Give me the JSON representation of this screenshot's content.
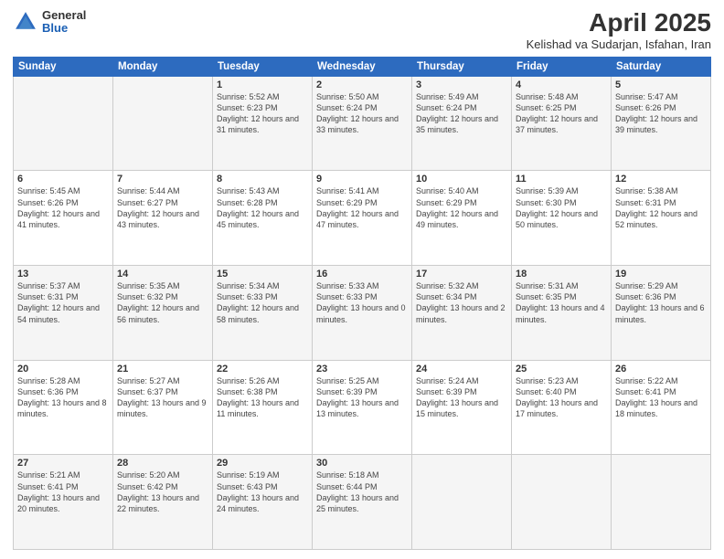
{
  "logo": {
    "general": "General",
    "blue": "Blue"
  },
  "header": {
    "title": "April 2025",
    "subtitle": "Kelishad va Sudarjan, Isfahan, Iran"
  },
  "days_of_week": [
    "Sunday",
    "Monday",
    "Tuesday",
    "Wednesday",
    "Thursday",
    "Friday",
    "Saturday"
  ],
  "weeks": [
    [
      {
        "day": "",
        "info": ""
      },
      {
        "day": "",
        "info": ""
      },
      {
        "day": "1",
        "info": "Sunrise: 5:52 AM\nSunset: 6:23 PM\nDaylight: 12 hours and 31 minutes."
      },
      {
        "day": "2",
        "info": "Sunrise: 5:50 AM\nSunset: 6:24 PM\nDaylight: 12 hours and 33 minutes."
      },
      {
        "day": "3",
        "info": "Sunrise: 5:49 AM\nSunset: 6:24 PM\nDaylight: 12 hours and 35 minutes."
      },
      {
        "day": "4",
        "info": "Sunrise: 5:48 AM\nSunset: 6:25 PM\nDaylight: 12 hours and 37 minutes."
      },
      {
        "day": "5",
        "info": "Sunrise: 5:47 AM\nSunset: 6:26 PM\nDaylight: 12 hours and 39 minutes."
      }
    ],
    [
      {
        "day": "6",
        "info": "Sunrise: 5:45 AM\nSunset: 6:26 PM\nDaylight: 12 hours and 41 minutes."
      },
      {
        "day": "7",
        "info": "Sunrise: 5:44 AM\nSunset: 6:27 PM\nDaylight: 12 hours and 43 minutes."
      },
      {
        "day": "8",
        "info": "Sunrise: 5:43 AM\nSunset: 6:28 PM\nDaylight: 12 hours and 45 minutes."
      },
      {
        "day": "9",
        "info": "Sunrise: 5:41 AM\nSunset: 6:29 PM\nDaylight: 12 hours and 47 minutes."
      },
      {
        "day": "10",
        "info": "Sunrise: 5:40 AM\nSunset: 6:29 PM\nDaylight: 12 hours and 49 minutes."
      },
      {
        "day": "11",
        "info": "Sunrise: 5:39 AM\nSunset: 6:30 PM\nDaylight: 12 hours and 50 minutes."
      },
      {
        "day": "12",
        "info": "Sunrise: 5:38 AM\nSunset: 6:31 PM\nDaylight: 12 hours and 52 minutes."
      }
    ],
    [
      {
        "day": "13",
        "info": "Sunrise: 5:37 AM\nSunset: 6:31 PM\nDaylight: 12 hours and 54 minutes."
      },
      {
        "day": "14",
        "info": "Sunrise: 5:35 AM\nSunset: 6:32 PM\nDaylight: 12 hours and 56 minutes."
      },
      {
        "day": "15",
        "info": "Sunrise: 5:34 AM\nSunset: 6:33 PM\nDaylight: 12 hours and 58 minutes."
      },
      {
        "day": "16",
        "info": "Sunrise: 5:33 AM\nSunset: 6:33 PM\nDaylight: 13 hours and 0 minutes."
      },
      {
        "day": "17",
        "info": "Sunrise: 5:32 AM\nSunset: 6:34 PM\nDaylight: 13 hours and 2 minutes."
      },
      {
        "day": "18",
        "info": "Sunrise: 5:31 AM\nSunset: 6:35 PM\nDaylight: 13 hours and 4 minutes."
      },
      {
        "day": "19",
        "info": "Sunrise: 5:29 AM\nSunset: 6:36 PM\nDaylight: 13 hours and 6 minutes."
      }
    ],
    [
      {
        "day": "20",
        "info": "Sunrise: 5:28 AM\nSunset: 6:36 PM\nDaylight: 13 hours and 8 minutes."
      },
      {
        "day": "21",
        "info": "Sunrise: 5:27 AM\nSunset: 6:37 PM\nDaylight: 13 hours and 9 minutes."
      },
      {
        "day": "22",
        "info": "Sunrise: 5:26 AM\nSunset: 6:38 PM\nDaylight: 13 hours and 11 minutes."
      },
      {
        "day": "23",
        "info": "Sunrise: 5:25 AM\nSunset: 6:39 PM\nDaylight: 13 hours and 13 minutes."
      },
      {
        "day": "24",
        "info": "Sunrise: 5:24 AM\nSunset: 6:39 PM\nDaylight: 13 hours and 15 minutes."
      },
      {
        "day": "25",
        "info": "Sunrise: 5:23 AM\nSunset: 6:40 PM\nDaylight: 13 hours and 17 minutes."
      },
      {
        "day": "26",
        "info": "Sunrise: 5:22 AM\nSunset: 6:41 PM\nDaylight: 13 hours and 18 minutes."
      }
    ],
    [
      {
        "day": "27",
        "info": "Sunrise: 5:21 AM\nSunset: 6:41 PM\nDaylight: 13 hours and 20 minutes."
      },
      {
        "day": "28",
        "info": "Sunrise: 5:20 AM\nSunset: 6:42 PM\nDaylight: 13 hours and 22 minutes."
      },
      {
        "day": "29",
        "info": "Sunrise: 5:19 AM\nSunset: 6:43 PM\nDaylight: 13 hours and 24 minutes."
      },
      {
        "day": "30",
        "info": "Sunrise: 5:18 AM\nSunset: 6:44 PM\nDaylight: 13 hours and 25 minutes."
      },
      {
        "day": "",
        "info": ""
      },
      {
        "day": "",
        "info": ""
      },
      {
        "day": "",
        "info": ""
      }
    ]
  ]
}
